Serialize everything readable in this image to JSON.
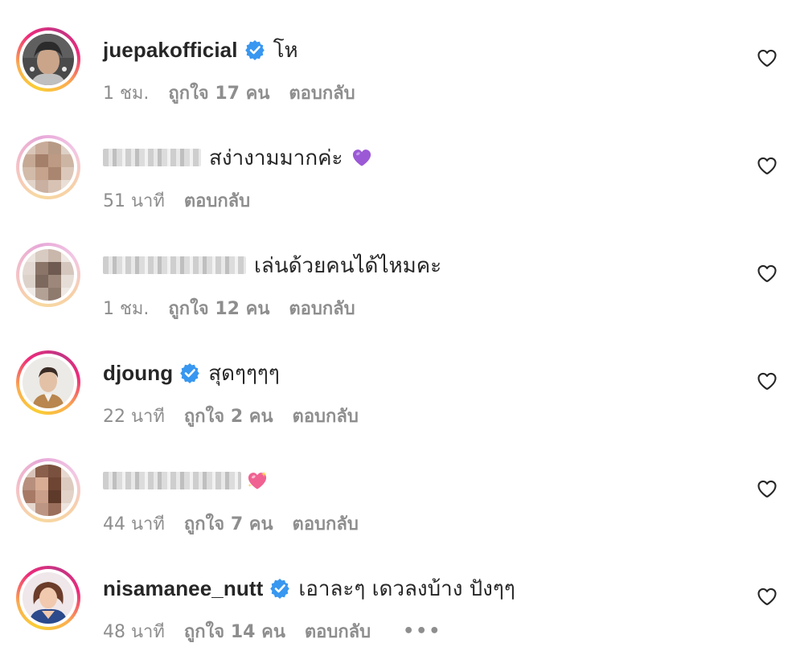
{
  "comments": [
    {
      "username": "juepakofficial",
      "verified": true,
      "text": "โห",
      "time": "1 ชม.",
      "likes": "ถูกใจ 17 คน",
      "reply": "ตอบกลับ"
    },
    {
      "username": "",
      "verified": false,
      "text": "สง่างามมากค่ะ",
      "emoji": "purple-heart",
      "time": "51 นาที",
      "likes": "",
      "reply": "ตอบกลับ"
    },
    {
      "username": "",
      "verified": false,
      "text": "เล่นด้วยคนได้ไหมคะ",
      "time": "1 ชม.",
      "likes": "ถูกใจ 12 คน",
      "reply": "ตอบกลับ"
    },
    {
      "username": "djoung",
      "verified": true,
      "text": "สุดๆๆๆๆ",
      "time": "22 นาที",
      "likes": "ถูกใจ 2 คน",
      "reply": "ตอบกลับ"
    },
    {
      "username": "",
      "verified": false,
      "text": "",
      "emoji": "sparkling-heart",
      "time": "44 นาที",
      "likes": "ถูกใจ 7 คน",
      "reply": "ตอบกลับ"
    },
    {
      "username": "nisamanee_nutt",
      "verified": true,
      "text": "เอาละๆ เดวลงบ้าง ปังๆๆ",
      "time": "48 นาที",
      "likes": "ถูกใจ 14 คน",
      "reply": "ตอบกลับ",
      "more": "•••"
    }
  ],
  "icons": {
    "like": "heart-outline-icon",
    "verified": "verified-badge-icon"
  },
  "colors": {
    "verified_blue": "#3897f0",
    "meta_gray": "#8e8e8e",
    "text": "#262626",
    "purple_heart": "#9b59d6",
    "sparkling_heart": "#f06292"
  }
}
